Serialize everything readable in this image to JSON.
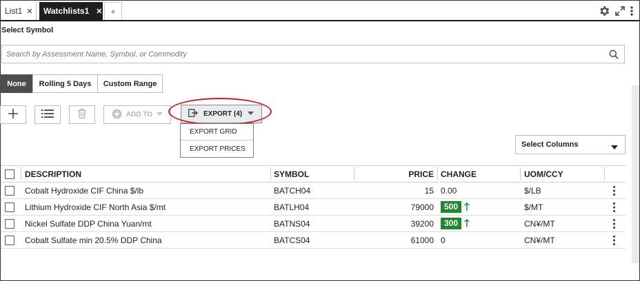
{
  "tabs": [
    {
      "label": "List1",
      "active": false
    },
    {
      "label": "Watchlists1",
      "active": true
    }
  ],
  "add_tab": "+",
  "select_symbol": "Select Symbol",
  "search": {
    "placeholder": "Search by Assessment Name, Symbol, or Commodity"
  },
  "range": {
    "options": [
      "None",
      "Rolling 5 Days",
      "Custom Range"
    ],
    "selected": "None"
  },
  "toolbar": {
    "add_to": "ADD TO",
    "export": "EXPORT (4)",
    "export_menu": [
      "EXPORT GRID",
      "EXPORT PRICES"
    ]
  },
  "select_columns": "Select Columns",
  "grid": {
    "columns": [
      "DESCRIPTION",
      "SYMBOL",
      "PRICE",
      "CHANGE",
      "UOM/CCY"
    ],
    "rows": [
      {
        "description": "Cobalt Hydroxide CIF China $/lb",
        "symbol": "BATCH04",
        "price": "15",
        "change": "0.00",
        "up": false,
        "uom": "$/LB"
      },
      {
        "description": "Lithium Hydroxide CIF North Asia $/mt",
        "symbol": "BATLH04",
        "price": "79000",
        "change": "500",
        "up": true,
        "uom": "$/MT"
      },
      {
        "description": "Nickel Sulfate DDP China Yuan/mt",
        "symbol": "BATNS04",
        "price": "39200",
        "change": "300",
        "up": true,
        "uom": "CN¥/MT"
      },
      {
        "description": "Cobalt Sulfate min 20.5% DDP China",
        "symbol": "BATCS04",
        "price": "61000",
        "change": "0",
        "up": false,
        "uom": "CN¥/MT"
      }
    ]
  },
  "colors": {
    "accent_dark": "#1f1f1f",
    "positive": "#1b8a2c",
    "highlight": "#d11a1a"
  }
}
